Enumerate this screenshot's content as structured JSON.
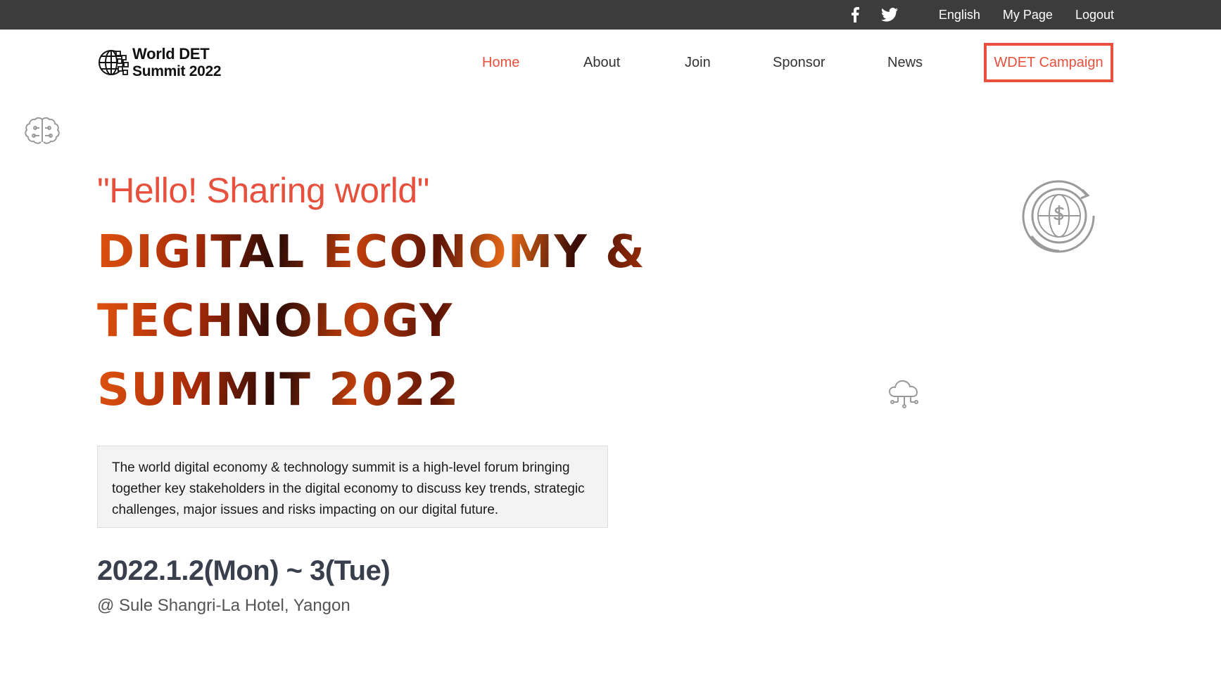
{
  "topbar": {
    "social": [
      {
        "icon": "facebook-icon",
        "glyph": "f"
      },
      {
        "icon": "twitter-icon"
      }
    ],
    "links": [
      "English",
      "My Page",
      "Logout"
    ]
  },
  "logo": {
    "line1": "World DET",
    "line2": "Summit 2022",
    "icon": "globe-circuit-icon"
  },
  "nav": {
    "items": [
      "Home",
      "About",
      "Join",
      "Sponsor",
      "News"
    ],
    "active": "Home",
    "campaign": "WDET Campaign"
  },
  "hero": {
    "tagline": "\"Hello! Sharing world\"",
    "title_lines": [
      "DIGITAL ECONOMY &",
      "TECHNOLOGY",
      "SUMMIT 2022"
    ],
    "description": "The world digital economy & technology summit is a high-level forum bringing together key stakeholders in the digital economy to discuss key trends, strategic challenges, major issues and risks impacting on our digital future.",
    "date": "2022.1.2(Mon) ~ 3(Tue)",
    "venue": "@ Sule Shangri-La Hotel, Yangon"
  },
  "decorations": [
    "brain-icon",
    "globe-dollar-icon",
    "cloud-network-icon"
  ],
  "colors": {
    "accent": "#e8503e",
    "topbar": "#3c3c3c",
    "date": "#3a3f4e"
  }
}
